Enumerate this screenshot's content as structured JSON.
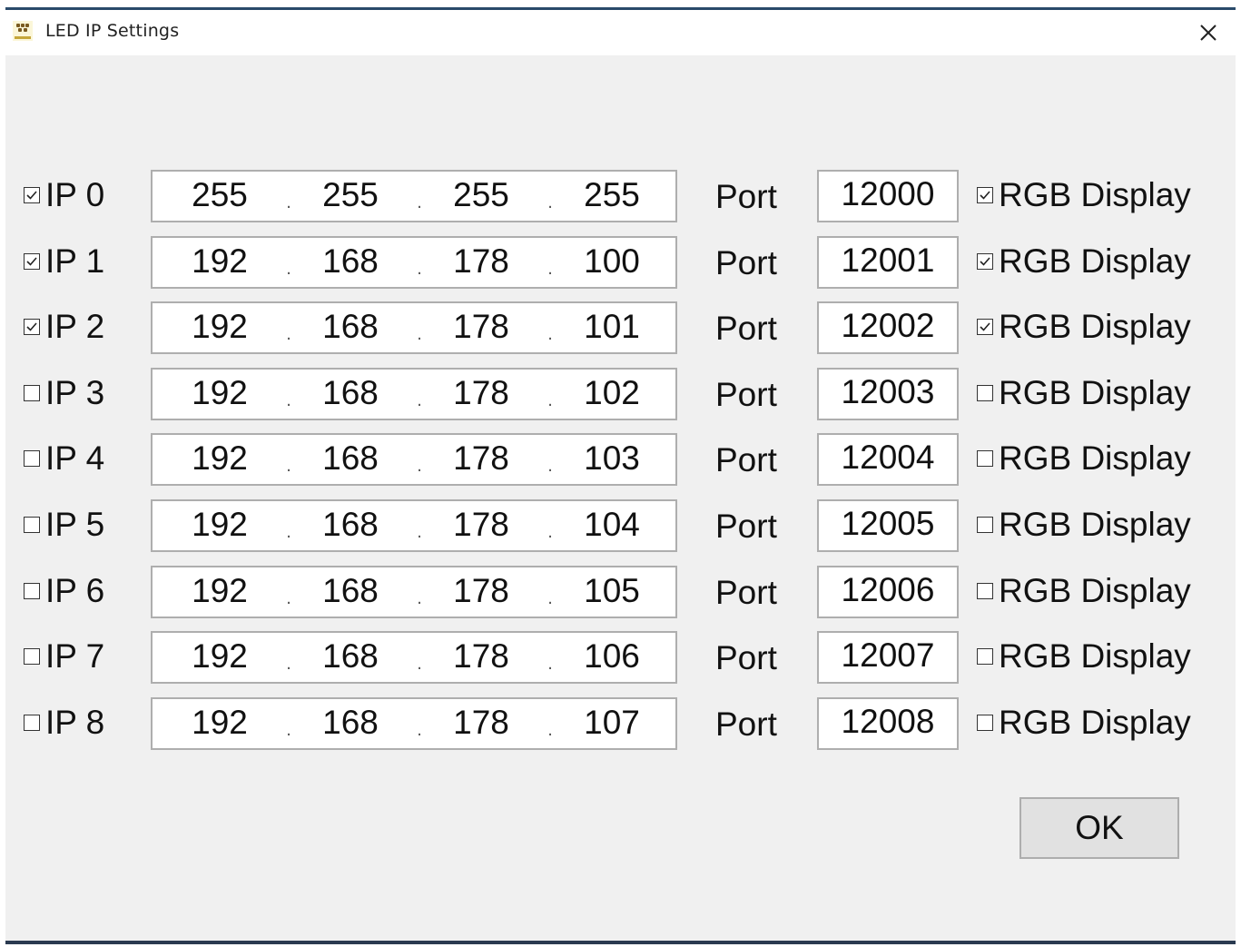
{
  "window": {
    "title": "LED IP Settings",
    "app_icon": "led-app-icon",
    "close_icon": "close-icon"
  },
  "rows": [
    {
      "label": "IP 0",
      "checked": true,
      "octets": [
        "255",
        "255",
        "255",
        "255"
      ],
      "port_label": "Port",
      "port": "12000",
      "rgb_label": "RGB Display",
      "rgb_checked": true
    },
    {
      "label": "IP 1",
      "checked": true,
      "octets": [
        "192",
        "168",
        "178",
        "100"
      ],
      "port_label": "Port",
      "port": "12001",
      "rgb_label": "RGB Display",
      "rgb_checked": true
    },
    {
      "label": "IP 2",
      "checked": true,
      "octets": [
        "192",
        "168",
        "178",
        "101"
      ],
      "port_label": "Port",
      "port": "12002",
      "rgb_label": "RGB Display",
      "rgb_checked": true
    },
    {
      "label": "IP 3",
      "checked": false,
      "octets": [
        "192",
        "168",
        "178",
        "102"
      ],
      "port_label": "Port",
      "port": "12003",
      "rgb_label": "RGB Display",
      "rgb_checked": false
    },
    {
      "label": "IP 4",
      "checked": false,
      "octets": [
        "192",
        "168",
        "178",
        "103"
      ],
      "port_label": "Port",
      "port": "12004",
      "rgb_label": "RGB Display",
      "rgb_checked": false
    },
    {
      "label": "IP 5",
      "checked": false,
      "octets": [
        "192",
        "168",
        "178",
        "104"
      ],
      "port_label": "Port",
      "port": "12005",
      "rgb_label": "RGB Display",
      "rgb_checked": false
    },
    {
      "label": "IP 6",
      "checked": false,
      "octets": [
        "192",
        "168",
        "178",
        "105"
      ],
      "port_label": "Port",
      "port": "12006",
      "rgb_label": "RGB Display",
      "rgb_checked": false
    },
    {
      "label": "IP 7",
      "checked": false,
      "octets": [
        "192",
        "168",
        "178",
        "106"
      ],
      "port_label": "Port",
      "port": "12007",
      "rgb_label": "RGB Display",
      "rgb_checked": false
    },
    {
      "label": "IP 8",
      "checked": false,
      "octets": [
        "192",
        "168",
        "178",
        "107"
      ],
      "port_label": "Port",
      "port": "12008",
      "rgb_label": "RGB Display",
      "rgb_checked": false
    }
  ],
  "buttons": {
    "ok_label": "OK"
  }
}
